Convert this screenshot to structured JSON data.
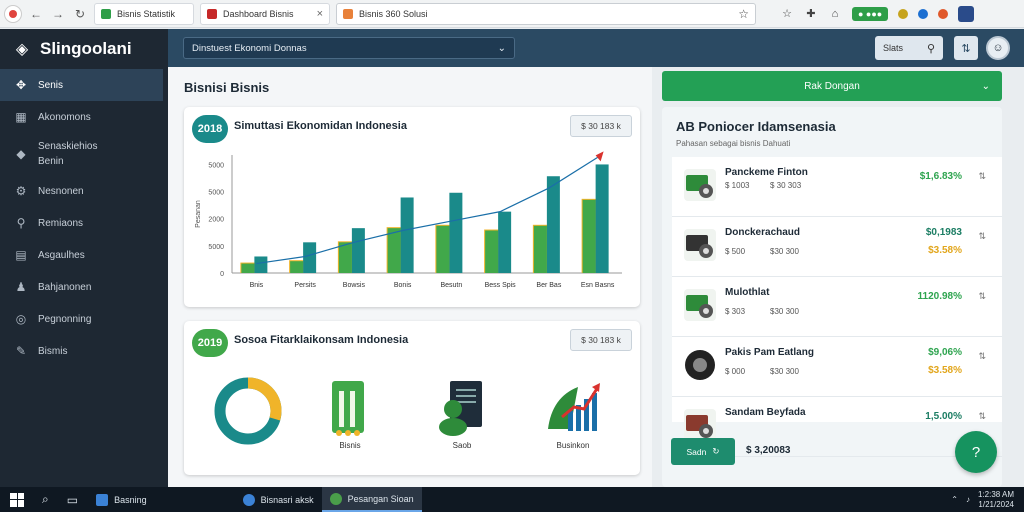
{
  "browser": {
    "tabs": [
      {
        "label": "Bisnis Statistik",
        "color": "#2e9e48"
      },
      {
        "label": "Dashboard Bisnis",
        "color": "#c62828"
      }
    ],
    "address": "Bisnis 360 Solusi",
    "ext_pill": "● ●●●",
    "icons": [
      "star-icon",
      "puzzle-icon",
      "home-icon"
    ]
  },
  "sidebar": {
    "brand": "Slingoolani",
    "items": [
      {
        "label": "Senis",
        "icon": "✥",
        "active": true
      },
      {
        "label": "Akonomons",
        "icon": "▦"
      },
      {
        "label": "Senaskiehios Benin",
        "icon": "◆"
      },
      {
        "label": "Nesnonen",
        "icon": "⚙"
      },
      {
        "label": "Remiaons",
        "icon": "⚲"
      },
      {
        "label": "Asgaulhes",
        "icon": "▤"
      },
      {
        "label": "Bahjanonen",
        "icon": "♟"
      },
      {
        "label": "Pegnonning",
        "icon": "◎"
      },
      {
        "label": "Bismis",
        "icon": "✎"
      }
    ]
  },
  "topbar": {
    "selector": "Dinstuest Ekonomi Donnas",
    "search_label": "Slats",
    "action_icon": "⇅"
  },
  "main": {
    "title": "Bisnisi Bisnis",
    "chart_card": {
      "badge": "2018",
      "title": "Simuttasi Ekonomidan Indonesia",
      "button": "$ 30 183 k"
    },
    "icons_card": {
      "badge": "2019",
      "title": "Sosoa Fitarklaikonsam Indonesia",
      "button": "$ 30 183 k",
      "tiles": [
        {
          "label": "",
          "icon": "donut-chart-icon"
        },
        {
          "label": "Bisnis",
          "icon": "document-icon"
        },
        {
          "label": "Saob",
          "icon": "person-document-icon"
        },
        {
          "label": "Businkon",
          "icon": "growth-chart-icon"
        }
      ]
    }
  },
  "chart_data": {
    "type": "bar",
    "categories": [
      "Bnis",
      "Persits",
      "Bowsis",
      "Bonis",
      "Besutn",
      "Bess Spis",
      "Ber Bas",
      "Esn Basns"
    ],
    "series": [
      {
        "values": [
          8,
          10,
          26,
          38,
          40,
          36,
          40,
          62
        ],
        "color": "#41a84a"
      },
      {
        "values": [
          14,
          26,
          38,
          64,
          68,
          52,
          82,
          92
        ],
        "color": "#1a8a8a"
      }
    ],
    "trend": [
      8,
      14,
      26,
      36,
      44,
      52,
      72,
      98
    ],
    "ylim": [
      0,
      100
    ],
    "yticks": [
      "0",
      "5000",
      "2000",
      "5000",
      "5000"
    ],
    "ylabel": "Pesanan"
  },
  "right": {
    "button": "Rak Dongan",
    "title": "AB Poniocer Idamsenasia",
    "subtitle": "Pahasan sebagai bisnis Dahuati",
    "list": [
      {
        "name": "Panckeme Finton",
        "meta": [
          "$ 1003",
          "$ 30 303"
        ],
        "v1": "$1,6.83%",
        "c1": "g",
        "v2": ""
      },
      {
        "name": "Donckerachaud",
        "meta": [
          "$ 500",
          "$30 300"
        ],
        "v1": "$0,1983",
        "c1": "t",
        "v2": "$3.58%",
        "c2": "y"
      },
      {
        "name": "Mulothlat",
        "meta": [
          "$ 303",
          "$30 300"
        ],
        "v1": "1120.98%",
        "c1": "g",
        "v2": ""
      },
      {
        "name": "Pakis Pam Eatlang",
        "meta": [
          "$ 000",
          "$30 300"
        ],
        "v1": "$9,06%",
        "c1": "g",
        "v2": "$3.58%",
        "c2": "y"
      },
      {
        "name": "Sandam Beyfada",
        "meta": [],
        "v1": "1,5.00%",
        "c1": "t",
        "v2": ""
      }
    ],
    "foot_button": "Sadn",
    "foot_value": "$ 3,20083",
    "fab_icon": "?"
  },
  "taskbar": {
    "search_icon": "⌕",
    "apps": [
      {
        "label": "Basning",
        "active": false
      },
      {
        "label": "Bisnasri aksk",
        "active": false
      },
      {
        "label": "Pesangan Sioan",
        "active": true
      }
    ],
    "time": "1:2:38 AM",
    "date": "1/21/2024"
  }
}
